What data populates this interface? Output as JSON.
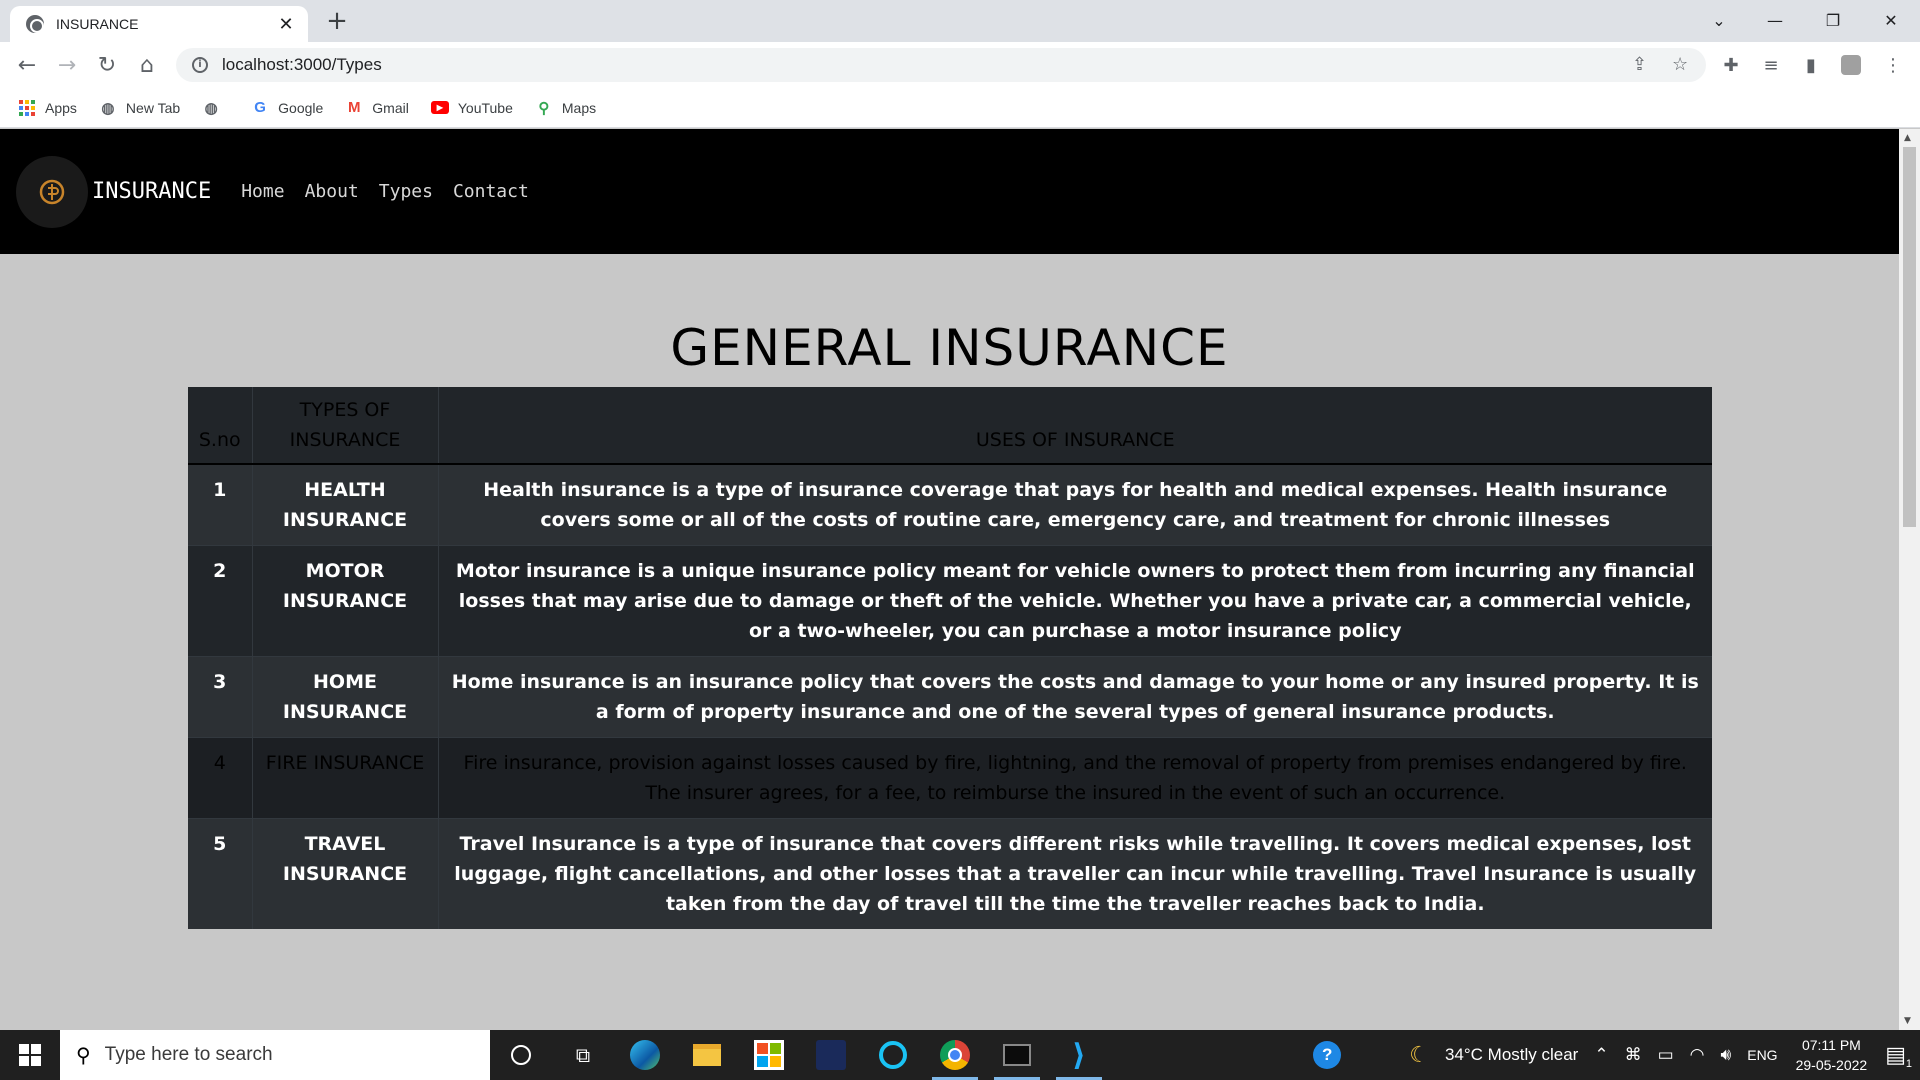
{
  "browser": {
    "tab_title": "INSURANCE",
    "url": "localhost:3000/Types",
    "bookmarks": [
      {
        "label": "Apps",
        "icon": "apps-icon"
      },
      {
        "label": "New Tab",
        "icon": "globe-icon"
      },
      {
        "label": "",
        "icon": "globe-icon"
      },
      {
        "label": "Google",
        "icon": "google-icon"
      },
      {
        "label": "Gmail",
        "icon": "gmail-icon"
      },
      {
        "label": "YouTube",
        "icon": "youtube-icon"
      },
      {
        "label": "Maps",
        "icon": "maps-icon"
      }
    ]
  },
  "site": {
    "brand": "INSURANCE",
    "nav": [
      "Home",
      "About",
      "Types",
      "Contact"
    ],
    "heading": "GENERAL INSURANCE"
  },
  "table": {
    "headers": [
      "S.no",
      "TYPES OF INSURANCE",
      "USES OF INSURANCE"
    ],
    "rows": [
      {
        "sno": "1",
        "type": "HEALTH INSURANCE",
        "uses": "Health insurance is a type of insurance coverage that pays for health and medical expenses. Health insurance covers some or all of the costs of routine care, emergency care, and treatment for chronic illnesses"
      },
      {
        "sno": "2",
        "type": "MOTOR INSURANCE",
        "uses": "Motor insurance is a unique insurance policy meant for vehicle owners to protect them from incurring any financial losses that may arise due to damage or theft of the vehicle. Whether you have a private car, a commercial vehicle, or a two-wheeler, you can purchase a motor insurance policy"
      },
      {
        "sno": "3",
        "type": "HOME INSURANCE",
        "uses": "Home insurance is an insurance policy that covers the costs and damage to your home or any insured property. It is a form of property insurance and one of the several types of general insurance products."
      },
      {
        "sno": "4",
        "type": "FIRE INSURANCE",
        "uses": "Fire insurance, provision against losses caused by fire, lightning, and the removal of property from premises endangered by fire. The insurer agrees, for a fee, to reimburse the insured in the event of such an occurrence."
      },
      {
        "sno": "5",
        "type": "TRAVEL INSURANCE",
        "uses": "Travel Insurance is a type of insurance that covers different risks while travelling. It covers medical expenses, lost luggage, flight cancellations, and other losses that a traveller can incur while travelling. Travel Insurance is usually taken from the day of travel till the time the traveller reaches back to India."
      }
    ]
  },
  "taskbar": {
    "search_placeholder": "Type here to search",
    "weather": "34°C  Mostly clear",
    "language": "ENG",
    "time": "07:11 PM",
    "date": "29-05-2022",
    "notification_count": "1"
  }
}
